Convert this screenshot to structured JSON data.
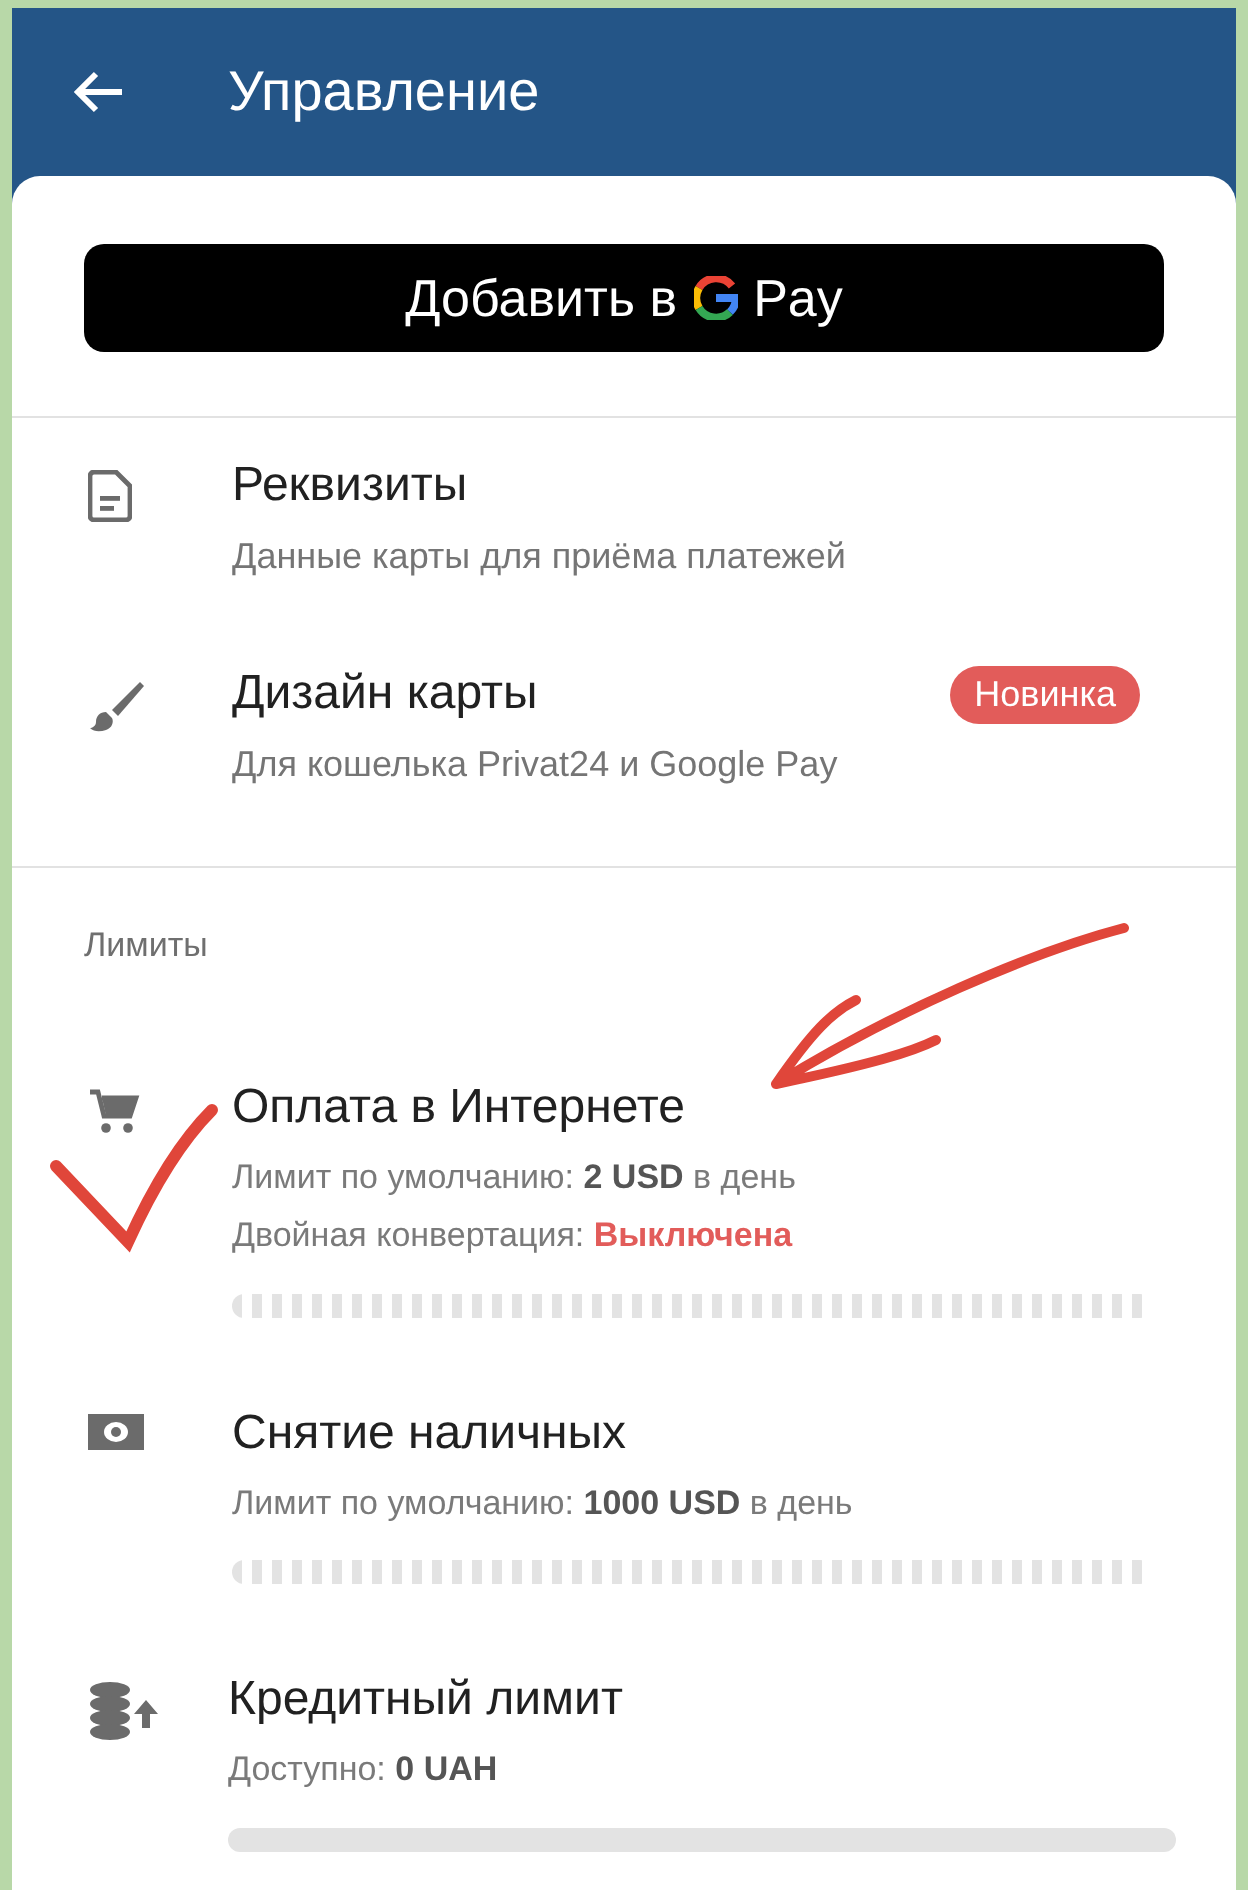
{
  "header": {
    "title": "Управление"
  },
  "pay_button": {
    "text": "Добавить в",
    "brand_text": "Pay"
  },
  "menu_items": [
    {
      "title": "Реквизиты",
      "subtitle": "Данные карты для приёма платежей"
    },
    {
      "title": "Дизайн карты",
      "subtitle": "Для кошелька Privat24 и Google Pay",
      "badge": "Новинка"
    }
  ],
  "limits": {
    "heading": "Лимиты",
    "items": [
      {
        "kind": "segmented",
        "title": "Оплата в Интернете",
        "lines": [
          {
            "text": "Лимит по умолчанию: **2 USD** в день"
          },
          {
            "text": "Двойная конвертация:",
            "value": "Выключена"
          }
        ]
      },
      {
        "kind": "segmented",
        "title": "Снятие наличных",
        "lines": [
          {
            "text": "Лимит по умолчанию: **1000 USD** в день"
          }
        ]
      },
      {
        "kind": "solid",
        "title": "Кредитный лимит",
        "lines": [
          {
            "text": "Доступно: **0 UAH**"
          }
        ]
      }
    ]
  }
}
